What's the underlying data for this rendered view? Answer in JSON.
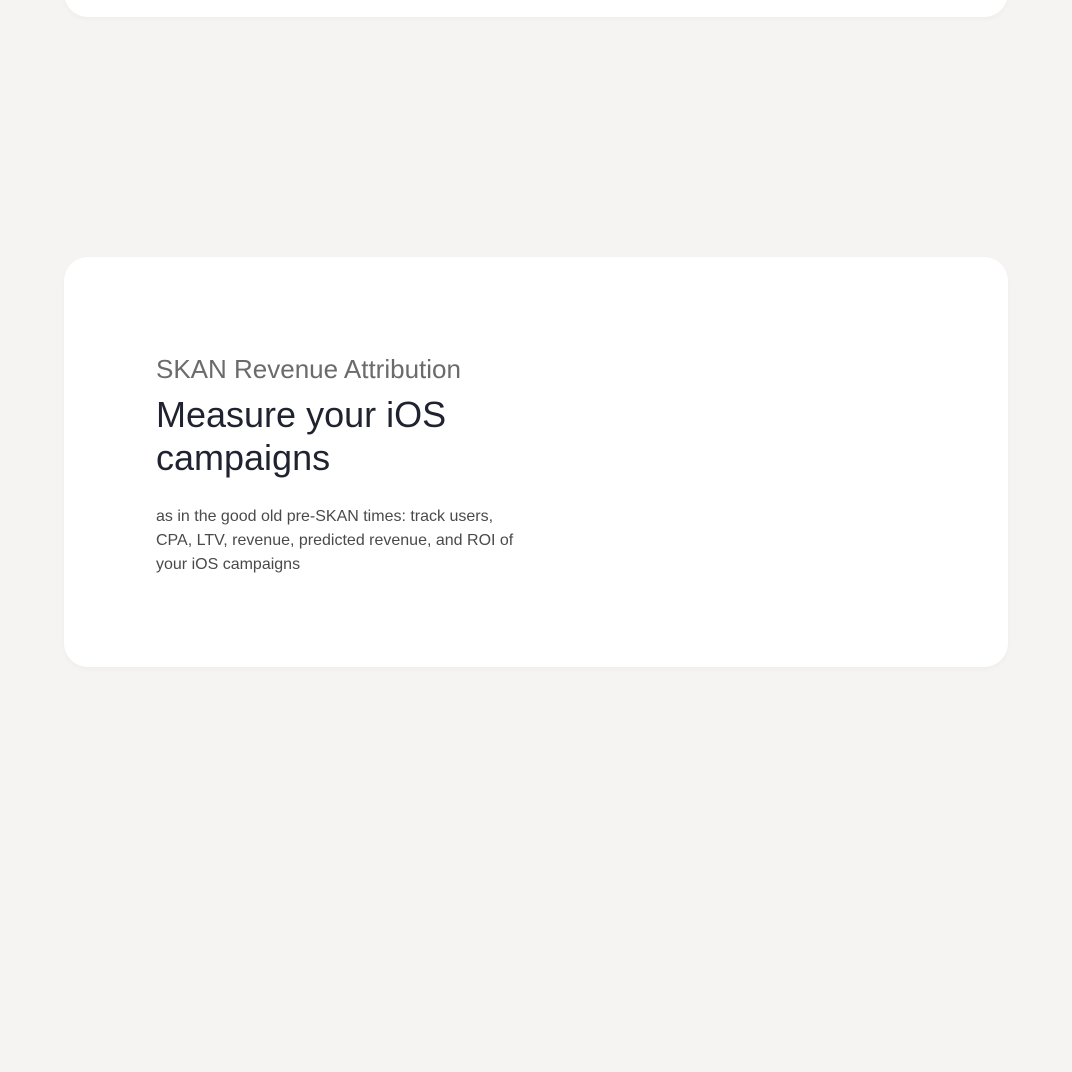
{
  "feature": {
    "eyebrow": "SKAN Revenue Attribution",
    "headline": "Measure your iOS campaigns",
    "description": "as in the good old pre-SKAN times: track users, CPA, LTV, revenue, predicted revenue, and ROI of your iOS campaigns"
  },
  "colors": {
    "page_background": "#f5f4f2",
    "card_background": "#ffffff",
    "eyebrow": "#6b6b6b",
    "headline": "#1f2330",
    "body_text": "#4a4a4a"
  }
}
